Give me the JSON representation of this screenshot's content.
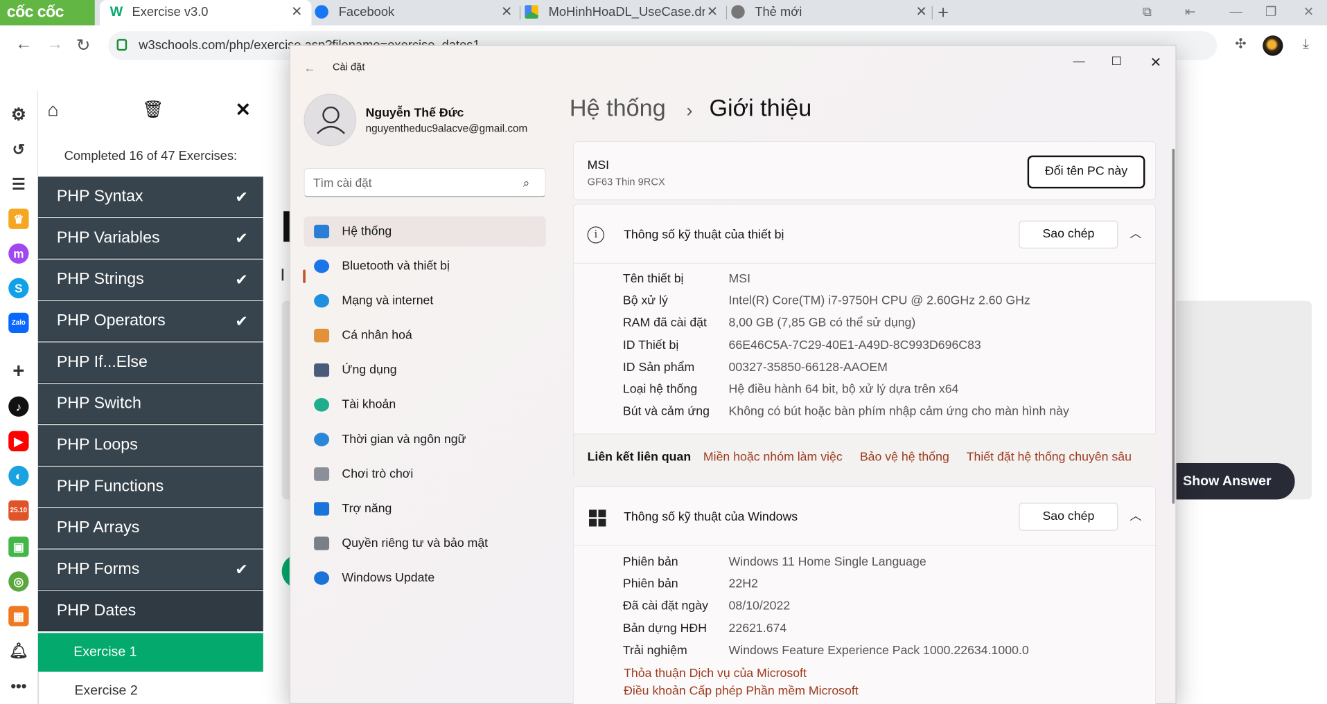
{
  "browser": {
    "logo": "cốc cốc",
    "tabs": [
      {
        "label": "Exercise v3.0",
        "active": true
      },
      {
        "label": "Facebook",
        "active": false
      },
      {
        "label": "MoHinhHoaDL_UseCase.draw",
        "active": false
      },
      {
        "label": "Thẻ mới",
        "active": false
      }
    ],
    "new_tab": "+",
    "address": "w3schools.com/php/exercise.asp?filename=exercise_dates1"
  },
  "w3": {
    "progress": "Completed 16 of 47 Exercises:",
    "chapters": [
      {
        "label": "PHP Syntax",
        "done": true
      },
      {
        "label": "PHP Variables",
        "done": true
      },
      {
        "label": "PHP Strings",
        "done": true
      },
      {
        "label": "PHP Operators",
        "done": true
      },
      {
        "label": "PHP If...Else",
        "done": false
      },
      {
        "label": "PHP Switch",
        "done": false
      },
      {
        "label": "PHP Loops",
        "done": false
      },
      {
        "label": "PHP Functions",
        "done": false
      },
      {
        "label": "PHP Arrays",
        "done": false
      },
      {
        "label": "PHP Forms",
        "done": true
      },
      {
        "label": "PHP Dates",
        "done": false
      }
    ],
    "exercises": [
      "Exercise 1",
      "Exercise 2"
    ],
    "show_answer": "Show Answer",
    "check": "✔"
  },
  "settings": {
    "window_title": "Cài đặt",
    "user": {
      "name": "Nguyễn Thế Đức",
      "email": "nguyentheduc9alacve@gmail.com"
    },
    "search_placeholder": "Tìm cài đặt",
    "nav": [
      {
        "label": "Hệ thống",
        "icon": "system-icon",
        "color": "#2a7fd4"
      },
      {
        "label": "Bluetooth và thiết bị",
        "icon": "bluetooth-icon",
        "color": "#1b74e8"
      },
      {
        "label": "Mạng và internet",
        "icon": "wifi-icon",
        "color": "#1f8fe0"
      },
      {
        "label": "Cá nhân hoá",
        "icon": "brush-icon",
        "color": "#e0913a"
      },
      {
        "label": "Ứng dụng",
        "icon": "apps-icon",
        "color": "#4a5a7a"
      },
      {
        "label": "Tài khoản",
        "icon": "account-icon",
        "color": "#1fae8c"
      },
      {
        "label": "Thời gian và ngôn ngữ",
        "icon": "clock-globe-icon",
        "color": "#2a86d6"
      },
      {
        "label": "Chơi trò chơi",
        "icon": "gamepad-icon",
        "color": "#8a8f99"
      },
      {
        "label": "Trợ năng",
        "icon": "accessibility-icon",
        "color": "#1a73d9"
      },
      {
        "label": "Quyền riêng tư và bảo mật",
        "icon": "shield-icon",
        "color": "#7a7f88"
      },
      {
        "label": "Windows Update",
        "icon": "update-icon",
        "color": "#1a73d9"
      }
    ],
    "breadcrumb": {
      "parent": "Hệ thống",
      "current": "Giới thiệu",
      "sep": "›"
    },
    "pc": {
      "name": "MSI",
      "model": "GF63 Thin 9RCX",
      "rename": "Đổi tên PC này"
    },
    "device_specs": {
      "title": "Thông số kỹ thuật của thiết bị",
      "copy": "Sao chép",
      "rows": [
        {
          "k": "Tên thiết bị",
          "v": "MSI"
        },
        {
          "k": "Bộ xử lý",
          "v": "Intel(R) Core(TM) i7-9750H CPU @ 2.60GHz   2.60 GHz"
        },
        {
          "k": "RAM đã cài đặt",
          "v": "8,00 GB (7,85 GB có thể sử dụng)"
        },
        {
          "k": "ID Thiết bị",
          "v": "66E46C5A-7C29-40E1-A49D-8C993D696C83"
        },
        {
          "k": "ID Sản phẩm",
          "v": "00327-35850-66128-AAOEM"
        },
        {
          "k": "Loại hệ thống",
          "v": "Hệ điều hành 64 bit, bộ xử lý dựa trên x64"
        },
        {
          "k": "Bút và cảm ứng",
          "v": "Không có bút hoặc bàn phím nhập cảm ứng cho màn hình này"
        }
      ]
    },
    "related": {
      "label": "Liên kết liên quan",
      "links": [
        "Miền hoặc nhóm làm việc",
        "Bảo vệ hệ thống",
        "Thiết đặt hệ thống chuyên sâu"
      ]
    },
    "windows_specs": {
      "title": "Thông số kỹ thuật của Windows",
      "copy": "Sao chép",
      "rows": [
        {
          "k": "Phiên bản",
          "v": "Windows 11 Home Single Language"
        },
        {
          "k": "Phiên bản",
          "v": "22H2"
        },
        {
          "k": "Đã cài đặt ngày",
          "v": "08/10/2022"
        },
        {
          "k": "Bản dựng HĐH",
          "v": "22621.674"
        },
        {
          "k": "Trải nghiệm",
          "v": "Windows Feature Experience Pack 1000.22634.1000.0"
        }
      ],
      "links": [
        "Thỏa thuận Dịch vụ của Microsoft",
        "Điều khoản Cấp phép Phần mềm Microsoft"
      ]
    }
  }
}
